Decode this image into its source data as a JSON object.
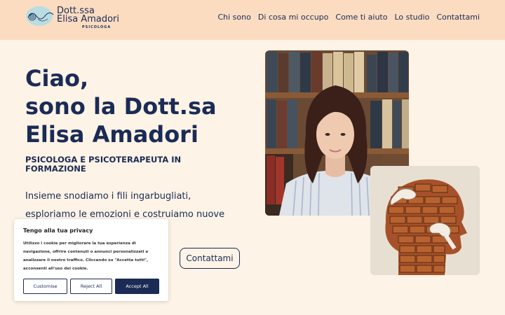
{
  "brand": {
    "name_line1": "Dott.ssa",
    "name_line2": "Elisa Amadori",
    "subtitle": "PSICOLOGA",
    "logo_icon": "yarn-wave-logo-icon"
  },
  "nav": {
    "items": [
      {
        "label": "Chi sono"
      },
      {
        "label": "Di cosa mi occupo"
      },
      {
        "label": "Come ti aiuto"
      },
      {
        "label": "Lo studio"
      },
      {
        "label": "Contattami"
      }
    ]
  },
  "hero": {
    "title_lines": [
      "Ciao,",
      "sono la Dott.sa",
      "Elisa Amadori"
    ],
    "subtitle": "PSICOLOGA E PSICOTERAPEUTA IN FORMAZIONE",
    "body": "Insieme snodiamo i fili ingarbugliati, esploriamo le emozioni e costruiamo nuove modalità di vivere il",
    "cta_label": "Contattami"
  },
  "cookie_banner": {
    "title": "Tengo alla tua privacy",
    "text": "Utilizzo i cookie per migliorare la tua esperienza di navigazione, offrire contenuti o annunci personalizzati e analizzare il nostro traffico. Cliccando su \"Accetta tutti\", acconsenti all'uso dei cookie.",
    "customise_label": "Customise",
    "reject_label": "Reject All",
    "accept_label": "Accept All"
  },
  "colors": {
    "header_bg": "#fbdcc1",
    "page_bg": "#fdf3e6",
    "brand_navy": "#1b2b55"
  }
}
